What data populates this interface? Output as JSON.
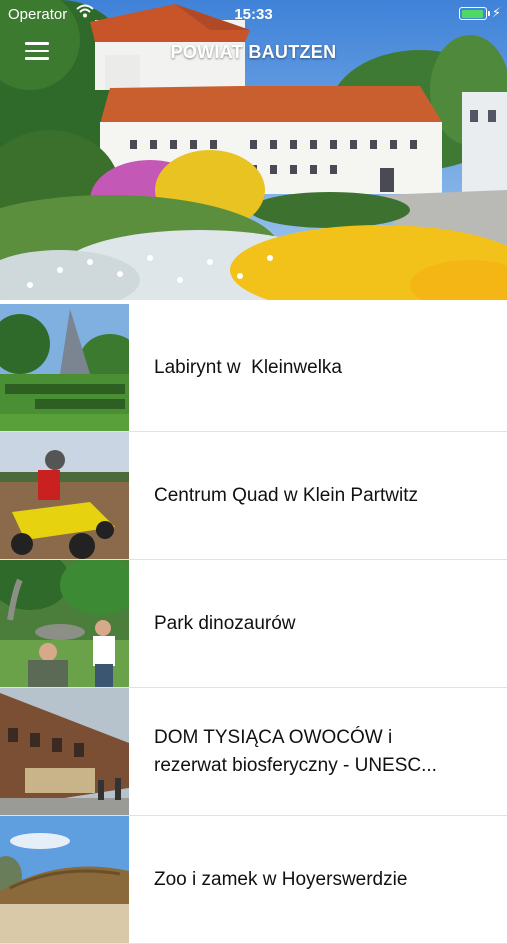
{
  "status_bar": {
    "carrier": "Operator",
    "time": "15:33",
    "battery_percent": 95,
    "battery_color": "#4cd964"
  },
  "nav": {
    "title": "POWIAT BAUTZEN",
    "menu_icon": "hamburger-icon"
  },
  "items": [
    {
      "label": "Labirynt w  Kleinwelka"
    },
    {
      "label": "Centrum Quad w Klein Partwitz"
    },
    {
      "label": "Park dinozaurów"
    },
    {
      "label": "DOM TYSIĄCA OWOCÓW i\nrezerwat biosferyczny - UNESC..."
    },
    {
      "label": "Zoo i zamek w Hoyerswerdzie"
    }
  ]
}
